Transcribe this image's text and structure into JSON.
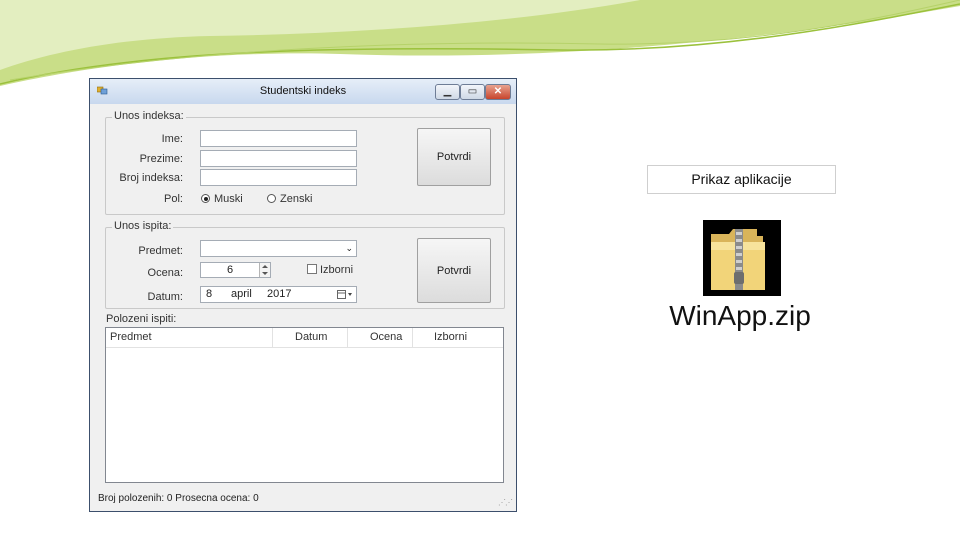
{
  "window": {
    "title": "Studentski indeks",
    "controls": [
      "minimize",
      "maximize",
      "close"
    ]
  },
  "index_group": {
    "label": "Unos indeksa:",
    "ime_label": "Ime:",
    "ime_value": "",
    "prezime_label": "Prezime:",
    "prezime_value": "",
    "broj_label": "Broj indeksa:",
    "broj_value": "",
    "pol_label": "Pol:",
    "pol_options": [
      "Muski",
      "Zenski"
    ],
    "pol_selected": "Muski",
    "confirm_label": "Potvrdi"
  },
  "exam_group": {
    "label": "Unos ispita:",
    "predmet_label": "Predmet:",
    "predmet_value": "",
    "ocena_label": "Ocena:",
    "ocena_value": "6",
    "izborni_label": "Izborni",
    "izborni_checked": false,
    "datum_label": "Datum:",
    "datum_day": "8",
    "datum_month": "april",
    "datum_year": "2017",
    "confirm_label": "Potvrdi"
  },
  "exams_list": {
    "label": "Polozeni ispiti:",
    "columns": [
      "Predmet",
      "Datum",
      "Ocena",
      "Izborni"
    ],
    "rows": []
  },
  "status_bar": {
    "text": "Broj polozenih: 0  Prosecna ocena: 0"
  },
  "side_panel": {
    "caption": "Prikaz aplikacije",
    "file_name": "WinApp.zip",
    "file_icon": "zip-folder-icon"
  },
  "colors": {
    "slide_accent": "#9bc13c",
    "window_border": "#3c4f6c",
    "window_bg": "#f0f0f0"
  }
}
